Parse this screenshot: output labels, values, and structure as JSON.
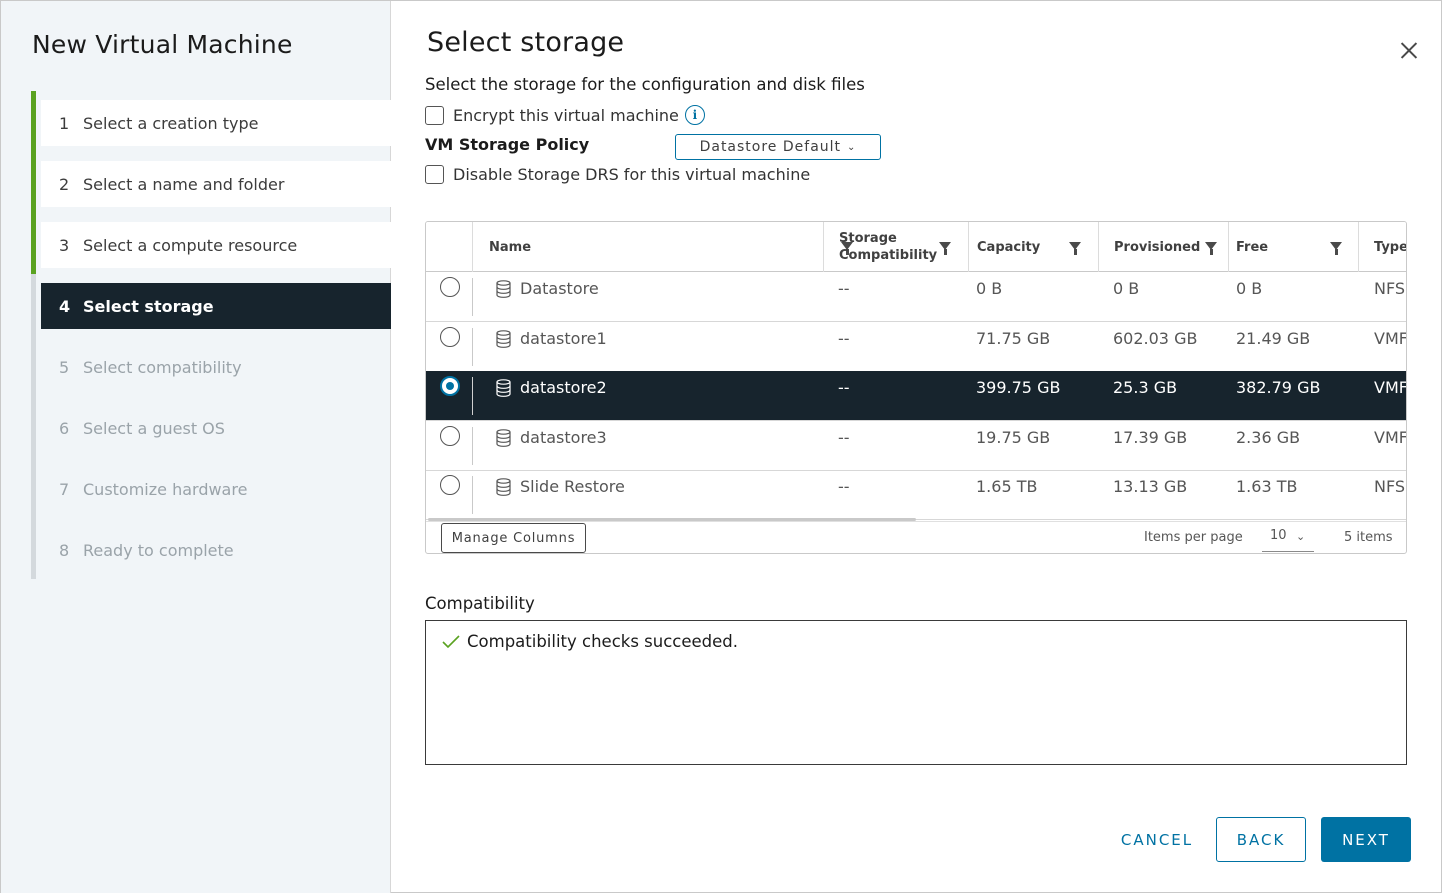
{
  "wizard": {
    "title": "New Virtual Machine",
    "steps": [
      {
        "num": "1",
        "label": "Select a creation type",
        "state": "done"
      },
      {
        "num": "2",
        "label": "Select a name and folder",
        "state": "done"
      },
      {
        "num": "3",
        "label": "Select a compute resource",
        "state": "done"
      },
      {
        "num": "4",
        "label": "Select storage",
        "state": "active"
      },
      {
        "num": "5",
        "label": "Select compatibility",
        "state": "todo"
      },
      {
        "num": "6",
        "label": "Select a guest OS",
        "state": "todo"
      },
      {
        "num": "7",
        "label": "Customize hardware",
        "state": "todo"
      },
      {
        "num": "8",
        "label": "Ready to complete",
        "state": "todo"
      }
    ]
  },
  "page": {
    "title": "Select storage",
    "subtitle": "Select the storage for the configuration and disk files",
    "encrypt_label": "Encrypt this virtual machine",
    "encrypt_checked": false,
    "policy_label": "VM Storage Policy",
    "policy_value": "Datastore Default",
    "disable_drs_label": "Disable Storage DRS for this virtual machine",
    "disable_drs_checked": false
  },
  "grid": {
    "columns": {
      "name": "Name",
      "storage_compat_1": "Storage",
      "storage_compat_2": "Compatibility",
      "capacity": "Capacity",
      "provisioned": "Provisioned",
      "free": "Free",
      "type": "Type"
    },
    "rows": [
      {
        "name": "Datastore",
        "compat": "--",
        "capacity": "0 B",
        "provisioned": "0 B",
        "free": "0 B",
        "type": "NFS",
        "selected": false
      },
      {
        "name": "datastore1",
        "compat": "--",
        "capacity": "71.75 GB",
        "provisioned": "602.03 GB",
        "free": "21.49 GB",
        "type": "VMF",
        "selected": false
      },
      {
        "name": "datastore2",
        "compat": "--",
        "capacity": "399.75 GB",
        "provisioned": "25.3 GB",
        "free": "382.79 GB",
        "type": "VMF",
        "selected": true
      },
      {
        "name": "datastore3",
        "compat": "--",
        "capacity": "19.75 GB",
        "provisioned": "17.39 GB",
        "free": "2.36 GB",
        "type": "VMF",
        "selected": false
      },
      {
        "name": "Slide Restore",
        "compat": "--",
        "capacity": "1.65 TB",
        "provisioned": "13.13 GB",
        "free": "1.63 TB",
        "type": "NFS",
        "selected": false
      }
    ],
    "footer": {
      "manage_columns": "Manage Columns",
      "items_per_page_label": "Items per page",
      "items_per_page_value": "10",
      "items_count": "5 items"
    }
  },
  "compatibility": {
    "label": "Compatibility",
    "message": "Compatibility checks succeeded."
  },
  "buttons": {
    "cancel": "CANCEL",
    "back": "BACK",
    "next": "NEXT"
  },
  "colors": {
    "accent": "#0072a3",
    "done_bar": "#5aa220",
    "active_step_bg": "#17242d",
    "selected_row_bg": "#17242d"
  },
  "icons": {
    "close": "close-icon",
    "info": "info-icon",
    "datastore": "datastore-icon",
    "filter": "filter-icon",
    "check": "check-icon",
    "chevron": "chevron-down-icon"
  }
}
